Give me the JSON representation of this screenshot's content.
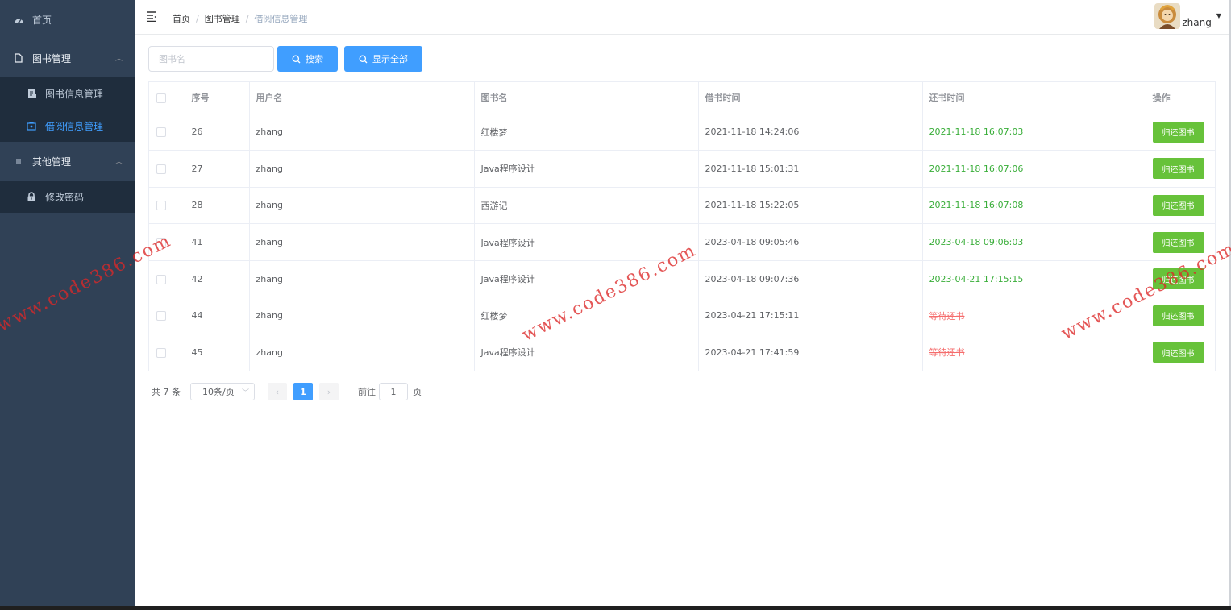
{
  "sidebar": {
    "items": [
      {
        "label": "首页",
        "icon": "dashboard-icon"
      },
      {
        "label": "图书管理",
        "icon": "document-icon",
        "children": [
          {
            "label": "图书信息管理",
            "icon": "book-list-icon"
          },
          {
            "label": "借阅信息管理",
            "icon": "borrow-icon",
            "active": true
          }
        ]
      },
      {
        "label": "其他管理",
        "icon": "menu-icon",
        "children": [
          {
            "label": "修改密码",
            "icon": "lock-icon"
          }
        ]
      }
    ]
  },
  "header": {
    "breadcrumb": [
      "首页",
      "图书管理",
      "借阅信息管理"
    ],
    "user": {
      "name": "zhang"
    }
  },
  "toolbar": {
    "search_placeholder": "图书名",
    "search_label": "搜索",
    "show_all_label": "显示全部"
  },
  "table": {
    "columns": [
      "序号",
      "用户名",
      "图书名",
      "借书时间",
      "还书时间",
      "操作"
    ],
    "rows": [
      {
        "id": "26",
        "user": "zhang",
        "book": "红楼梦",
        "borrow_time": "2021-11-18 14:24:06",
        "return_time": "2021-11-18 16:07:03",
        "status": "returned",
        "action": "归还图书"
      },
      {
        "id": "27",
        "user": "zhang",
        "book": "Java程序设计",
        "borrow_time": "2021-11-18 15:01:31",
        "return_time": "2021-11-18 16:07:06",
        "status": "returned",
        "action": "归还图书"
      },
      {
        "id": "28",
        "user": "zhang",
        "book": "西游记",
        "borrow_time": "2021-11-18 15:22:05",
        "return_time": "2021-11-18 16:07:08",
        "status": "returned",
        "action": "归还图书"
      },
      {
        "id": "41",
        "user": "zhang",
        "book": "Java程序设计",
        "borrow_time": "2023-04-18 09:05:46",
        "return_time": "2023-04-18 09:06:03",
        "status": "returned",
        "action": "归还图书"
      },
      {
        "id": "42",
        "user": "zhang",
        "book": "Java程序设计",
        "borrow_time": "2023-04-18 09:07:36",
        "return_time": "2023-04-21 17:15:15",
        "status": "returned",
        "action": "归还图书"
      },
      {
        "id": "44",
        "user": "zhang",
        "book": "红楼梦",
        "borrow_time": "2023-04-21 17:15:11",
        "return_time": "等待还书",
        "status": "pending",
        "action": "归还图书"
      },
      {
        "id": "45",
        "user": "zhang",
        "book": "Java程序设计",
        "borrow_time": "2023-04-21 17:41:59",
        "return_time": "等待还书",
        "status": "pending",
        "action": "归还图书"
      }
    ]
  },
  "pagination": {
    "total_text": "共 7 条",
    "page_size": "10条/页",
    "current_page": "1",
    "goto_label": "前往",
    "goto_value": "1",
    "goto_suffix": "页"
  },
  "watermark": {
    "text": "www.code386.com"
  },
  "colors": {
    "sidebar_bg": "#304156",
    "submenu_bg": "#1f2d3d",
    "primary": "#409eff",
    "success": "#67c23a",
    "returned_text": "#3aae3a",
    "pending_text": "#f56c6c"
  }
}
